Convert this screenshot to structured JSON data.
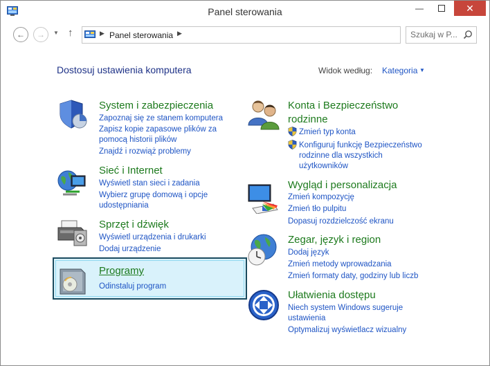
{
  "window": {
    "title": "Panel sterowania"
  },
  "address": {
    "crumb": "Panel sterowania"
  },
  "search": {
    "placeholder": "Szukaj w P..."
  },
  "main": {
    "heading": "Dostosuj ustawienia komputera",
    "view_label": "Widok według:",
    "view_value": "Kategoria"
  },
  "categories": [
    {
      "title": "System i zabezpieczenia",
      "links": [
        "Zapoznaj się ze stanem komputera",
        "Zapisz kopie zapasowe plików za",
        "pomocą historii plików",
        "Znajdź i rozwiąż problemy"
      ]
    },
    {
      "title": "Sieć i Internet",
      "links": [
        "Wyświetl stan sieci i zadania",
        "Wybierz grupę domową i opcje",
        "udostępniania"
      ]
    },
    {
      "title": "Sprzęt i dźwięk",
      "links": [
        "Wyświetl urządzenia i drukarki",
        "Dodaj urządzenie"
      ]
    },
    {
      "title": "Programy",
      "links": [
        "Odinstaluj program"
      ]
    },
    {
      "title_line1": "Konta i Bezpieczeństwo",
      "title_line2": "rodzinne",
      "links": [
        "Zmień typ konta",
        "Konfiguruj funkcję Bezpieczeństwo",
        "rodzinne dla wszystkich",
        "użytkowników"
      ]
    },
    {
      "title": "Wygląd i personalizacja",
      "links": [
        "Zmień kompozycję",
        "Zmień tło pulpitu",
        "Dopasuj rozdzielczość ekranu"
      ]
    },
    {
      "title": "Zegar, język i region",
      "links": [
        "Dodaj język",
        "Zmień metody wprowadzania",
        "Zmień formaty daty, godziny lub liczb"
      ]
    },
    {
      "title": "Ułatwienia dostępu",
      "links": [
        "Niech system Windows sugeruje",
        "ustawienia",
        "Optymalizuj wyświetlacz wizualny"
      ]
    }
  ],
  "icons": {
    "system": "shield-icon",
    "network": "globe-network-icon",
    "hardware": "printer-icon",
    "programs": "programs-box-icon",
    "accounts": "users-icon",
    "appearance": "monitor-paint-icon",
    "clock": "globe-clock-icon",
    "ease": "ease-of-access-icon",
    "uac": "uac-shield-icon"
  },
  "colors": {
    "link": "#1e54c4",
    "category_title": "#1d7a1d",
    "heading": "#1e3287",
    "close": "#c7463b",
    "highlight": "#d9f2fb"
  }
}
